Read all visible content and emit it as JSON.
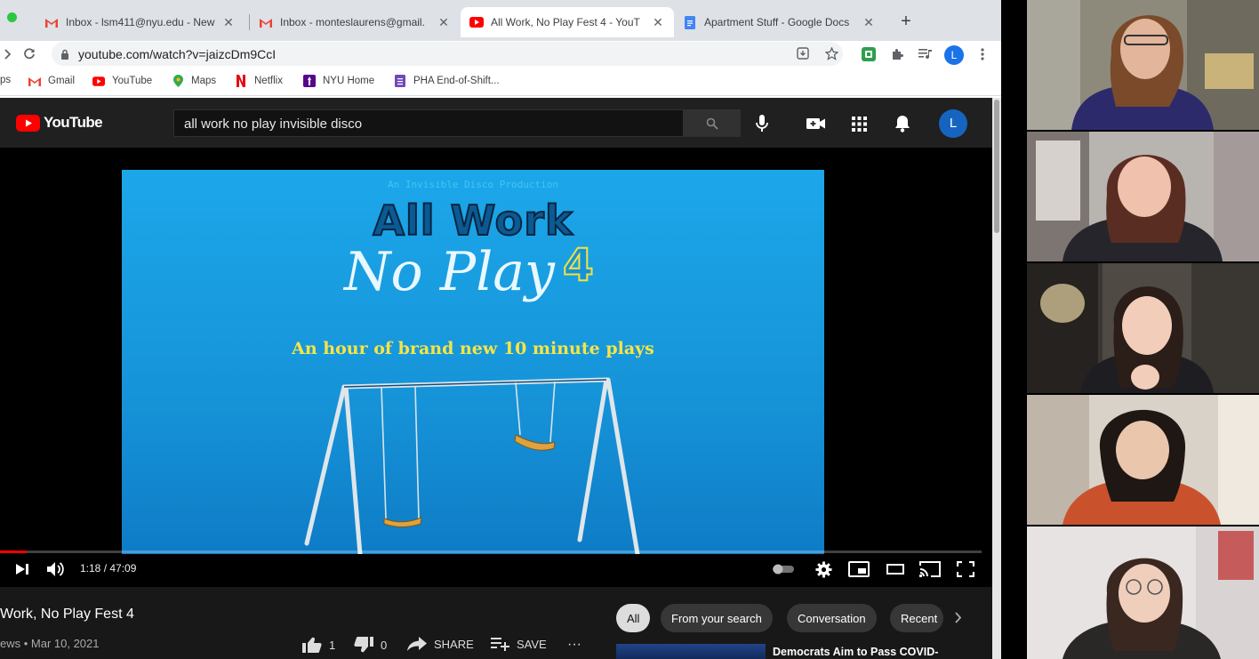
{
  "browser": {
    "tabs": [
      {
        "title": "Inbox - lsm411@nyu.edu - New",
        "favicon": "gmail-icon"
      },
      {
        "title": "Inbox - monteslaurens@gmail.",
        "favicon": "gmail-icon"
      },
      {
        "title": "All Work, No Play Fest 4 - YouT",
        "favicon": "youtube-icon"
      },
      {
        "title": "Apartment Stuff - Google Docs",
        "favicon": "docs-icon"
      }
    ],
    "url": "youtube.com/watch?v=jaizcDm9CcI",
    "profile_initial": "L",
    "bookmarks": [
      {
        "label": "Gmail",
        "icon": "gmail-icon"
      },
      {
        "label": "YouTube",
        "icon": "youtube-icon"
      },
      {
        "label": "Maps",
        "icon": "maps-icon"
      },
      {
        "label": "Netflix",
        "icon": "netflix-icon"
      },
      {
        "label": "NYU Home",
        "icon": "nyu-icon"
      },
      {
        "label": "PHA End-of-Shift...",
        "icon": "form-icon"
      }
    ],
    "bookmark_partial": "ps"
  },
  "youtube": {
    "logo_text": "YouTube",
    "search_query": "all work no play invisible disco",
    "avatar_initial": "L",
    "video": {
      "production_line": "An Invisible Disco Production",
      "title_line1": "All Work",
      "title_line2": "No Play",
      "title_number": "4",
      "tagline": "An hour of brand new 10 minute plays"
    },
    "player": {
      "time_current": "1:18",
      "time_total": "47:09",
      "progress_fraction": 0.0276
    },
    "video_title": "Work, No Play Fest 4",
    "meta": "ews • Mar 10, 2021",
    "likes": "1",
    "dislikes": "0",
    "share_label": "SHARE",
    "save_label": "SAVE",
    "more_label": "···",
    "chips": [
      "All",
      "From your search",
      "Conversation",
      "Recent"
    ],
    "related_headline": "Democrats Aim to Pass COVID-"
  },
  "colors": {
    "youtube_red": "#ff0000",
    "slide_blue": "#1693d8",
    "tagline_yellow": "#f5e546"
  }
}
